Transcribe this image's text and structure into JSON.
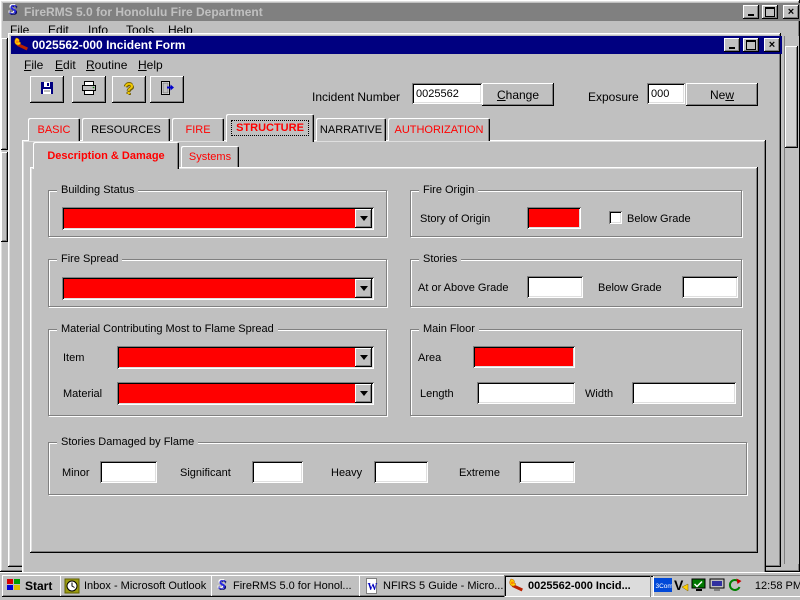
{
  "colors": {
    "titlebar_active": "#000080",
    "titlebar_inactive": "#808080",
    "titlebar_inactive_text": "#c0c0c0",
    "required_field": "#ff0000",
    "tab_text_red": "#ff0000",
    "chrome": "#c0c0c0"
  },
  "main_window": {
    "title": "FireRMS 5.0 for Honolulu Fire Department",
    "menu": [
      {
        "label": "File",
        "u": 0
      },
      {
        "label": "Edit",
        "u": 0
      },
      {
        "label": "Info",
        "u": 0
      },
      {
        "label": "Tools",
        "u": 0
      },
      {
        "label": "Help",
        "u": 0
      }
    ]
  },
  "dialog": {
    "title": "0025562-000 Incident Form",
    "menu": [
      {
        "label": "File",
        "u": 0
      },
      {
        "label": "Edit",
        "u": 0
      },
      {
        "label": "Routine",
        "u": 0
      },
      {
        "label": "Help",
        "u": 0
      }
    ],
    "toolbar": {
      "buttons": [
        "save",
        "print",
        "help",
        "exit"
      ],
      "help_glyph": "?"
    },
    "header": {
      "incident_number_label": "Incident Number",
      "incident_number_value": "0025562",
      "change_button": {
        "label": "Change",
        "u": 0
      },
      "exposure_label": "Exposure",
      "exposure_value": "000",
      "new_button": {
        "label": "New",
        "u": 2
      }
    },
    "tabs": [
      {
        "label": "BASIC",
        "red": true,
        "active": false
      },
      {
        "label": "RESOURCES",
        "red": false,
        "active": false
      },
      {
        "label": "FIRE",
        "red": true,
        "active": false
      },
      {
        "label": "STRUCTURE",
        "red": true,
        "active": true
      },
      {
        "label": "NARRATIVE",
        "red": false,
        "active": false
      },
      {
        "label": "AUTHORIZATION",
        "red": true,
        "active": false
      }
    ],
    "subtabs": [
      {
        "label": "Description & Damage",
        "active": true
      },
      {
        "label": "Systems",
        "active": false
      }
    ],
    "form": {
      "building_status": {
        "title": "Building Status",
        "value": ""
      },
      "fire_origin": {
        "title": "Fire Origin",
        "story_of_origin_label": "Story of Origin",
        "story_of_origin_value": "",
        "below_grade_label": "Below Grade",
        "below_grade_checked": false
      },
      "fire_spread": {
        "title": "Fire Spread",
        "value": ""
      },
      "stories": {
        "title": "Stories",
        "at_or_above_grade_label": "At or Above Grade",
        "at_or_above_grade_value": "",
        "below_grade_label": "Below Grade",
        "below_grade_value": ""
      },
      "material": {
        "title": "Material Contributing Most to Flame Spread",
        "item_label": "Item",
        "item_value": "",
        "material_label": "Material",
        "material_value": ""
      },
      "main_floor": {
        "title": "Main Floor",
        "area_label": "Area",
        "area_value": "",
        "length_label": "Length",
        "length_value": "",
        "width_label": "Width",
        "width_value": ""
      },
      "stories_damaged": {
        "title": "Stories Damaged by Flame",
        "minor_label": "Minor",
        "minor_value": "",
        "significant_label": "Significant",
        "significant_value": "",
        "heavy_label": "Heavy",
        "heavy_value": "",
        "extreme_label": "Extreme",
        "extreme_value": ""
      }
    }
  },
  "taskbar": {
    "start_label": "Start",
    "tasks": [
      {
        "label": "Inbox - Microsoft Outlook",
        "icon": "outlook-icon",
        "active": false
      },
      {
        "label": "FireRMS 5.0 for Honol...",
        "icon": "firerms-icon",
        "active": false
      },
      {
        "label": "NFIRS 5 Guide - Micro...",
        "icon": "word-icon",
        "active": false
      },
      {
        "label": "0025562-000 Incid...",
        "icon": "flame-icon",
        "active": true
      }
    ],
    "tray": {
      "icons": [
        "3com-icon",
        "virus-scan-icon",
        "network-icon",
        "display-icon",
        "refresh-icon"
      ],
      "clock": "12:58 PM"
    }
  }
}
